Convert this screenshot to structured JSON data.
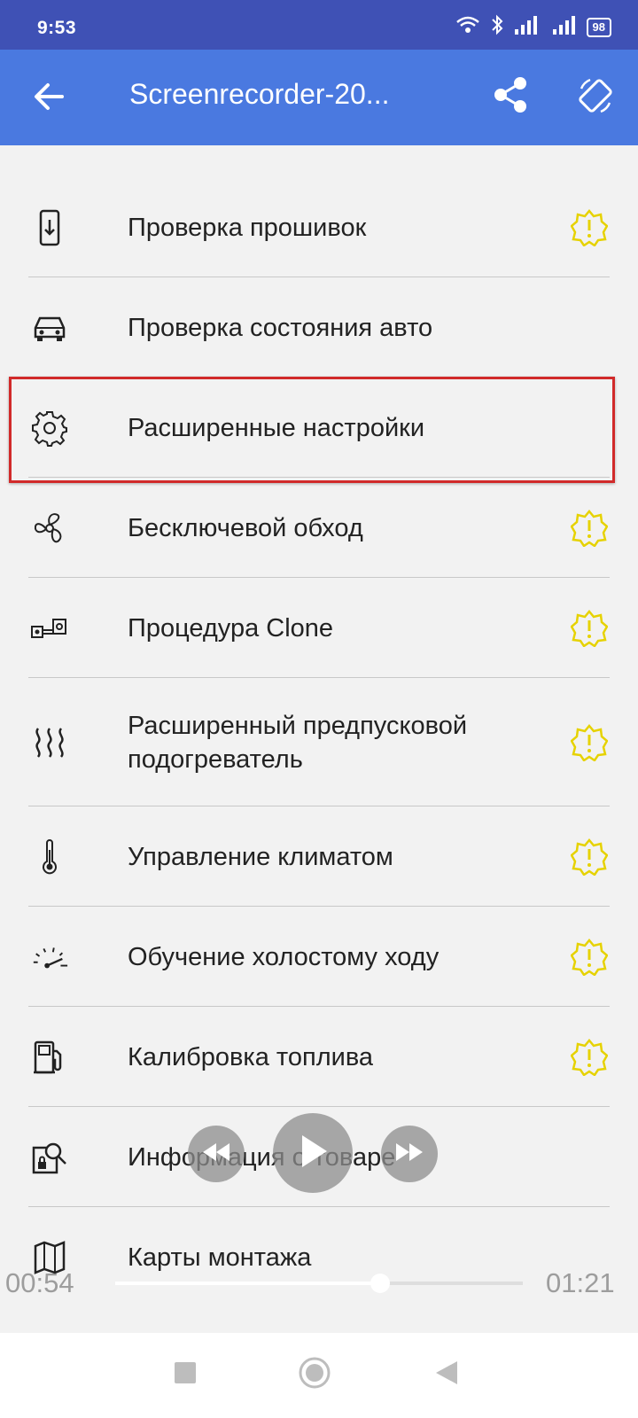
{
  "status_bar": {
    "time": "9:53",
    "battery": "98"
  },
  "app_bar": {
    "title": "Screenrecorder-20...",
    "back_icon": "arrow-left-icon",
    "share_icon": "share-icon",
    "rotate_icon": "screen-rotation-icon"
  },
  "menu": {
    "items": [
      {
        "label": "Проверка прошивок",
        "icon": "phone-download-icon",
        "warning": true
      },
      {
        "label": "Проверка состояния авто",
        "icon": "car-icon",
        "warning": false
      },
      {
        "label": "Расширенные настройки",
        "icon": "gear-icon",
        "warning": false,
        "highlighted": true
      },
      {
        "label": "Бесключевой обход",
        "icon": "fan-icon",
        "warning": true
      },
      {
        "label": "Процедура Clone",
        "icon": "clone-module-icon",
        "warning": true
      },
      {
        "label": "Расширенный предпусковой подогреватель",
        "icon": "heat-waves-icon",
        "warning": true
      },
      {
        "label": "Управление климатом",
        "icon": "thermometer-icon",
        "warning": true
      },
      {
        "label": "Обучение холостому ходу",
        "icon": "gauge-icon",
        "warning": true
      },
      {
        "label": "Калибровка топлива",
        "icon": "fuel-pump-icon",
        "warning": true
      },
      {
        "label": "Информация о товаре",
        "icon": "product-search-icon",
        "warning": false
      },
      {
        "label": "Карты монтажа",
        "icon": "map-icon",
        "warning": false
      }
    ]
  },
  "player": {
    "current_time": "00:54",
    "total_time": "01:21",
    "progress": 0.65
  },
  "colors": {
    "status_bar": "#3f51b5",
    "app_bar": "#4a79e0",
    "warning": "#e6d200",
    "highlight_border": "#d12a2a"
  }
}
